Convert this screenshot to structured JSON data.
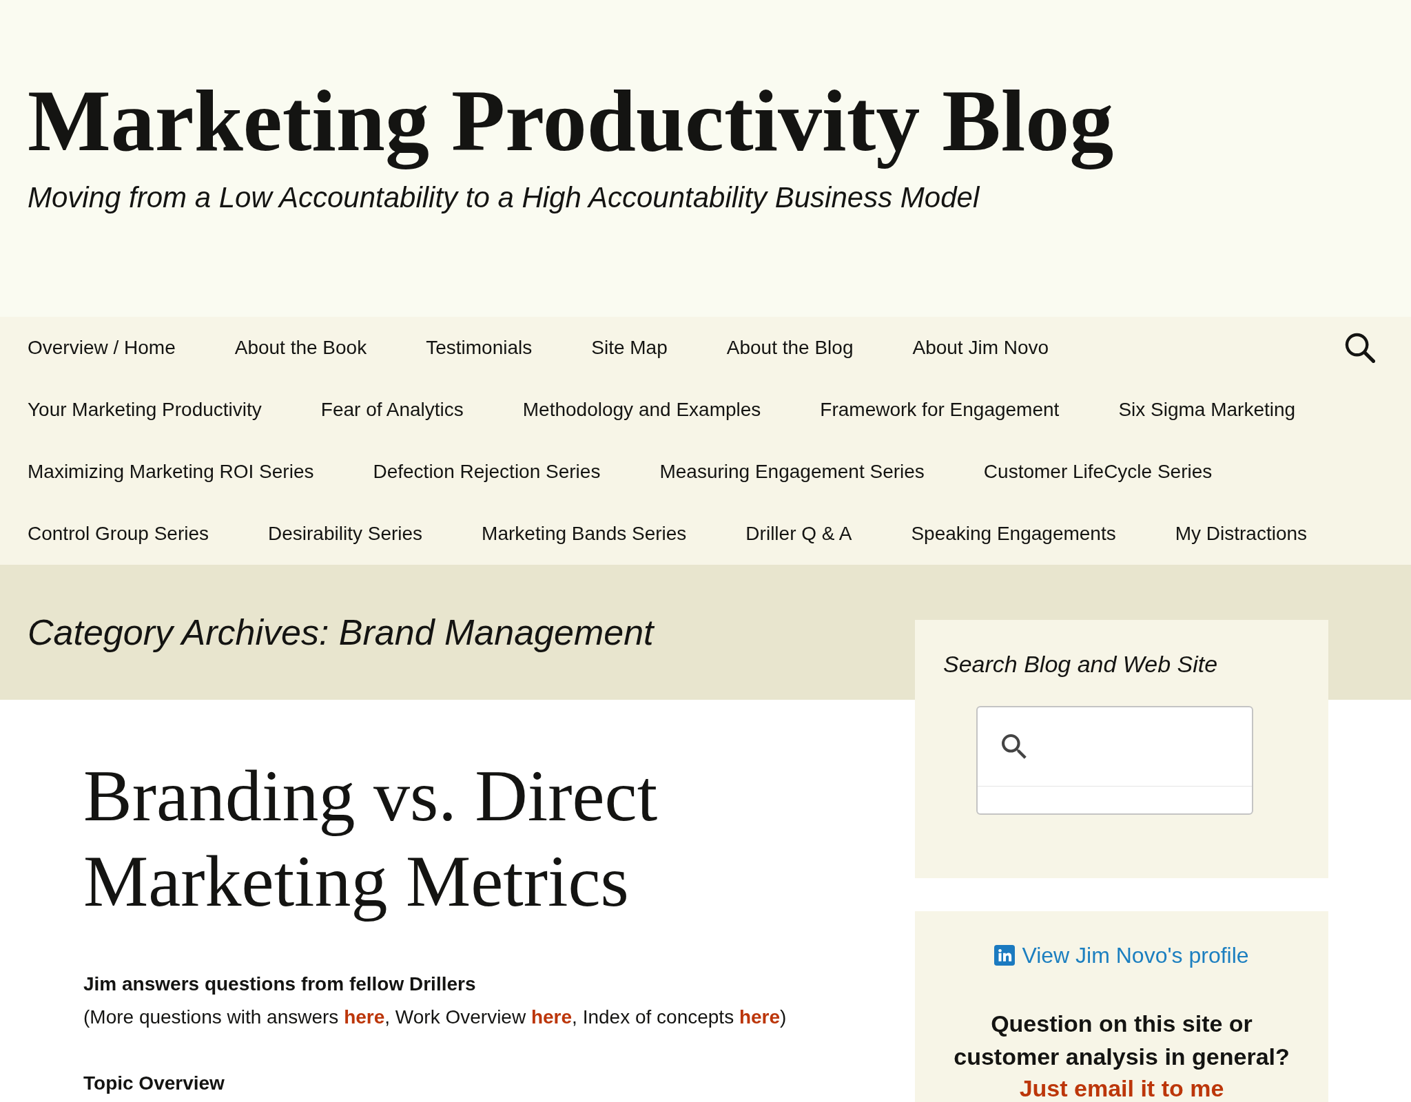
{
  "header": {
    "title": "Marketing Productivity Blog",
    "tagline": "Moving from a Low Accountability to a High Accountability Business Model"
  },
  "nav": {
    "rows": [
      {
        "items": [
          "Overview / Home",
          "About the Book",
          "Testimonials",
          "Site Map",
          "About the Blog",
          "About Jim Novo"
        ]
      },
      {
        "items": [
          "Your Marketing Productivity",
          "Fear of Analytics",
          "Methodology and Examples",
          "Framework for Engagement",
          "Six Sigma Marketing"
        ]
      },
      {
        "items": [
          "Maximizing Marketing ROI Series",
          "Defection Rejection Series",
          "Measuring Engagement Series",
          "Customer LifeCycle Series"
        ]
      },
      {
        "items": [
          "Control Group Series",
          "Desirability Series",
          "Marketing Bands Series",
          "Driller Q & A",
          "Speaking Engagements",
          "My Distractions"
        ]
      }
    ]
  },
  "archive": {
    "title": "Category Archives: Brand Management"
  },
  "post": {
    "title": "Branding vs. Direct Marketing Metrics",
    "blocks": [
      {
        "kind": "lead",
        "text": "Jim answers questions from fellow Drillers"
      },
      {
        "kind": "links",
        "parts": [
          {
            "kind": "text",
            "text": "(More questions with answers "
          },
          {
            "kind": "link",
            "text": "here"
          },
          {
            "kind": "text",
            "text": ", Work Overview "
          },
          {
            "kind": "link",
            "text": "here"
          },
          {
            "kind": "text",
            "text": ", Index of concepts "
          },
          {
            "kind": "link",
            "text": "here"
          },
          {
            "kind": "text",
            "text": ")"
          }
        ]
      },
      {
        "kind": "heading",
        "text": "Topic Overview"
      }
    ]
  },
  "sidebar": {
    "widgets": [
      {
        "kind": "search",
        "title": "Search Blog and Web Site"
      },
      {
        "kind": "contact",
        "profile_link": "View Jim Novo's profile",
        "question": "Question on this site or customer analysis in general?",
        "email_link": "Just email it to me"
      }
    ]
  }
}
